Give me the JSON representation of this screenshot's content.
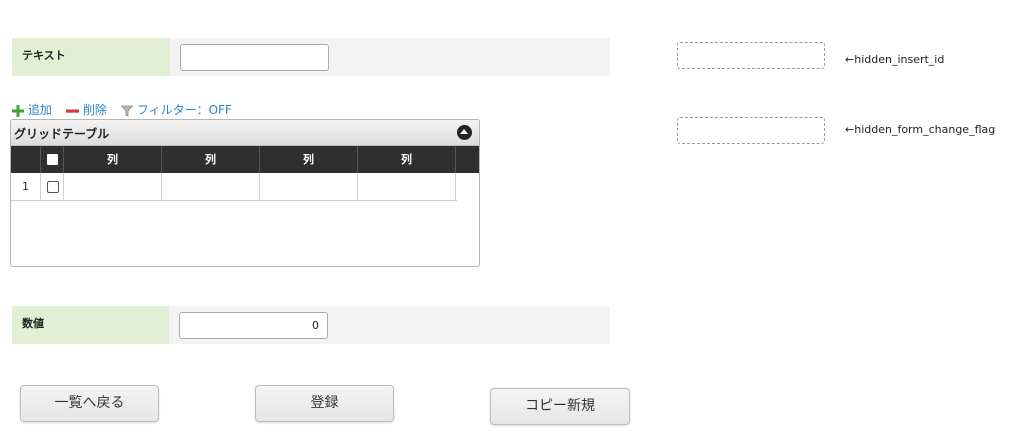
{
  "form": {
    "text_label": "テキスト",
    "text_value": "",
    "number_label": "数値",
    "number_value": "0"
  },
  "hidden": {
    "insert_id_label": "←hidden_insert_id",
    "form_change_flag_label": "←hidden_form_change_flag"
  },
  "toolbar": {
    "add_label": "追加",
    "delete_label": "削除",
    "filter_label": "フィルター：OFF"
  },
  "grid": {
    "caption": "グリッドテーブル",
    "columns": [
      "列",
      "列",
      "列",
      "列"
    ],
    "rows": [
      {
        "number": "1",
        "cells": [
          "",
          "",
          "",
          ""
        ]
      }
    ]
  },
  "buttons": {
    "back_label": "一覧へ戻る",
    "register_label": "登録",
    "copy_new_label": "コピー新規"
  },
  "colors": {
    "label_bg": "#e2efd5",
    "row_bg": "#f3f3f3",
    "link": "#2b86c8",
    "add_icon": "#3aa23a",
    "delete_icon": "#d33a3a",
    "grid_header": "#2f2f2f"
  },
  "icons": [
    "plus-icon",
    "minus-icon",
    "filter-icon",
    "chevron-up-icon"
  ]
}
